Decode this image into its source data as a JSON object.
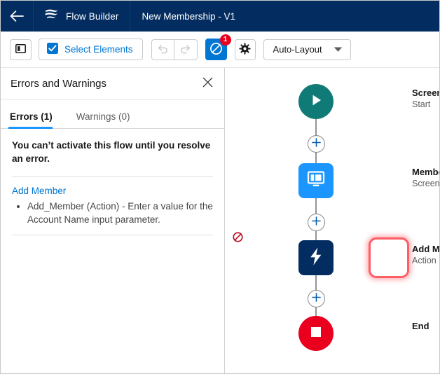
{
  "header": {
    "back_icon": "arrow-left-icon",
    "app_logo_icon": "flow-builder-logo-icon",
    "app_name": "Flow Builder",
    "flow_name": "New Membership - V1",
    "bg_color": "#032d60"
  },
  "toolbar": {
    "toggle_panel_icon": "panel-toggle-icon",
    "select_elements_icon": "select-elements-icon",
    "select_elements_label": "Select Elements",
    "undo_icon": "undo-icon",
    "redo_icon": "redo-icon",
    "error_icon": "error-circle-slash-icon",
    "error_badge_count": "1",
    "settings_icon": "gear-icon",
    "layout_label": "Auto-Layout",
    "layout_chevron_icon": "chevron-down-icon",
    "accent_color": "#0176d3",
    "badge_color": "#ea001e"
  },
  "panel": {
    "title": "Errors and Warnings",
    "close_icon": "close-icon",
    "tabs": [
      {
        "label": "Errors (1)",
        "active": true
      },
      {
        "label": "Warnings (0)",
        "active": false
      }
    ],
    "headline": "You can’t activate this flow until you resolve an error.",
    "error_group_link": "Add Member",
    "error_items": [
      "Add_Member (Action) - Enter a value for the Account Name input parameter."
    ]
  },
  "canvas": {
    "nodes": [
      {
        "name": "Screen Flow",
        "type": "Start",
        "icon": "play-start-icon",
        "shape": "circle",
        "color": "#107b76",
        "has_error": false
      },
      {
        "name": "Membership Signup",
        "type": "Screen",
        "icon": "screen-monitor-icon",
        "shape": "square",
        "color": "#1b96ff",
        "has_error": false
      },
      {
        "name": "Add Member",
        "type": "Action",
        "icon": "lightning-bolt-icon",
        "shape": "square",
        "color": "#032d60",
        "has_error": true,
        "error_badge_icon": "error-circle-slash-icon",
        "error_ring_color": "#ff5d64"
      },
      {
        "name": "End",
        "type": "",
        "icon": "stop-square-icon",
        "shape": "circle",
        "color": "#ea001e",
        "has_error": false
      }
    ],
    "connector_add_icon": "plus-icon",
    "connector_count": 3,
    "connector_color": "#939393"
  }
}
